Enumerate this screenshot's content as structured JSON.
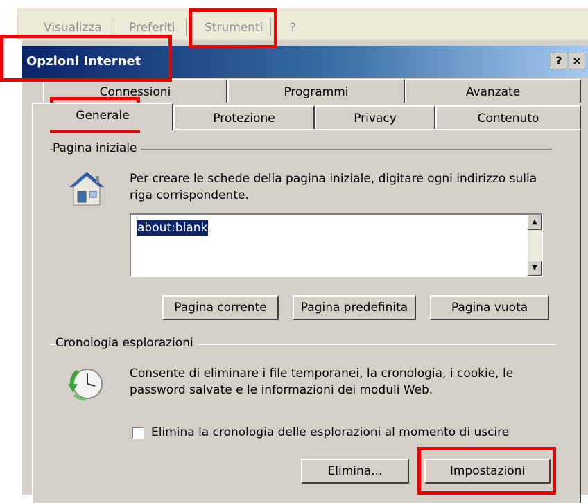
{
  "menubar": {
    "items": [
      {
        "label": "Visualizza"
      },
      {
        "label": "Preferiti"
      },
      {
        "label": "Strumenti"
      },
      {
        "label": "?"
      }
    ]
  },
  "dialog": {
    "title": "Opzioni Internet",
    "help_button": "?",
    "close_button": "×",
    "tabs_back": [
      {
        "label": "Connessioni"
      },
      {
        "label": "Programmi"
      },
      {
        "label": "Avanzate"
      }
    ],
    "tabs_front": [
      {
        "label": "Generale",
        "selected": true
      },
      {
        "label": "Protezione"
      },
      {
        "label": "Privacy"
      },
      {
        "label": "Contenuto"
      }
    ],
    "homepage": {
      "group_label": "Pagina iniziale",
      "description": "Per creare le schede della pagina iniziale, digitare ogni indirizzo sulla riga corrispondente.",
      "value": "about:blank",
      "buttons": {
        "current": "Pagina corrente",
        "default": "Pagina predefinita",
        "blank": "Pagina vuota"
      }
    },
    "history": {
      "group_label": "Cronologia esplorazioni",
      "description": "Consente di eliminare i file temporanei, la cronologia, i cookie, le password salvate e le informazioni dei moduli Web.",
      "checkbox_label": "Elimina la cronologia delle esplorazioni al momento di uscire",
      "checkbox_checked": false,
      "buttons": {
        "delete": "Elimina...",
        "settings": "Impostazioni"
      }
    }
  },
  "colors": {
    "dialog_bg": "#d4d0c8",
    "title_gradient_start": "#0a246a",
    "title_gradient_end": "#a6caf0",
    "highlight": "#ee0000",
    "selection": "#0a246a"
  },
  "icons": {
    "homepage": "house-icon",
    "history": "clock-refresh-icon"
  }
}
